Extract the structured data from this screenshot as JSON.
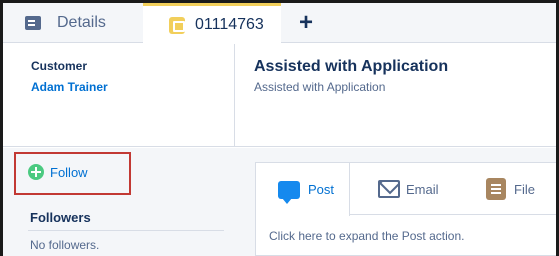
{
  "tabs": {
    "details_label": "Details",
    "case_label": "01114763",
    "add_label": "+"
  },
  "highlights": {
    "customer_label": "Customer",
    "customer_value": "Adam Trainer",
    "title": "Assisted with Application",
    "subtitle": "Assisted with Application"
  },
  "sidebar": {
    "follow_label": "Follow",
    "followers_heading": "Followers",
    "no_followers_text": "No followers."
  },
  "publisher": {
    "tabs": [
      {
        "label": "Post",
        "icon": "post-icon"
      },
      {
        "label": "Email",
        "icon": "email-icon"
      },
      {
        "label": "File",
        "icon": "file-icon"
      }
    ],
    "expand_text": "Click here to expand the Post action."
  },
  "colors": {
    "link": "#0070d2",
    "case_accent": "#f2cf5b",
    "follow_plus": "#4bca81",
    "highlight_box": "#c23934",
    "text_dark": "#16325c"
  }
}
